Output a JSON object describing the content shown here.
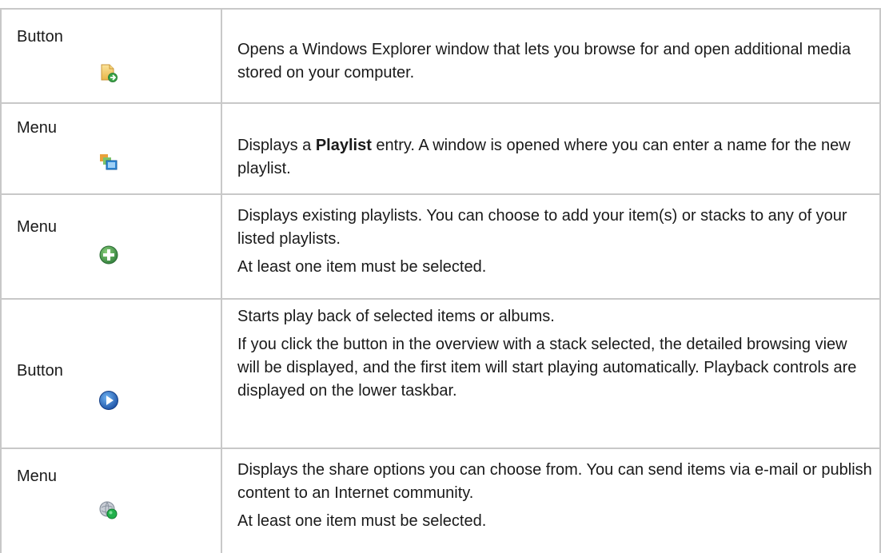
{
  "rows": [
    {
      "type": "Button",
      "icon": "folder-open-icon",
      "description": "Opens a Windows Explorer window that lets you browse for and open additional media stored on your computer."
    },
    {
      "type": "Menu",
      "icon": "playlist-windows-icon",
      "desc_pre": "Displays a ",
      "desc_bold": "Playlist",
      "desc_post": " entry. A window is opened where you can enter a name for the new playlist."
    },
    {
      "type": "Menu",
      "icon": "add-plus-icon",
      "description": "Displays existing playlists. You can choose to add your item(s) or stacks to any of your listed playlists.",
      "note": "At least one item must be selected."
    },
    {
      "type": "Button",
      "icon": "play-icon",
      "description": "Starts play back of selected items or albums.",
      "description2": "If you click the button in the overview with a stack selected, the detailed browsing view will be displayed, and the first item will start playing automatically. Playback controls are displayed on the lower taskbar."
    },
    {
      "type": "Menu",
      "icon": "share-globe-icon",
      "description": "Displays the share options you can choose from. You can send items via e-mail or publish content to an Internet community.",
      "note": "At least one item must be selected."
    }
  ]
}
